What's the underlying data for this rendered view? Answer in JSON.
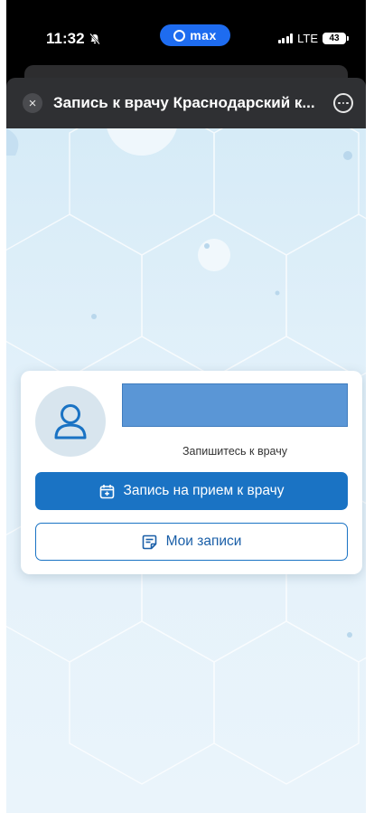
{
  "status_bar": {
    "time": "11:32",
    "app_pill": "MAX",
    "network": "LTE",
    "battery": "43"
  },
  "header": {
    "close_symbol": "×",
    "title": "Запись к врачу Краснодарский к..."
  },
  "card": {
    "subtitle": "Запишитесь к врачу",
    "appointment_button": "Запись на прием к врачу",
    "records_button": "Мои записи"
  },
  "icons": {
    "bell": "bell-slash-icon",
    "app": "max-logo-icon",
    "signal": "signal-icon",
    "battery": "battery-icon",
    "close": "close-icon",
    "more": "more-icon",
    "avatar": "user-icon",
    "calendar": "calendar-plus-icon",
    "records": "document-list-icon"
  },
  "colors": {
    "primary": "#1a73c4",
    "header_bg": "#2f3033",
    "pill": "#1e6cf0",
    "redacted": "#5a96d6",
    "background": "#d6ebf7"
  }
}
